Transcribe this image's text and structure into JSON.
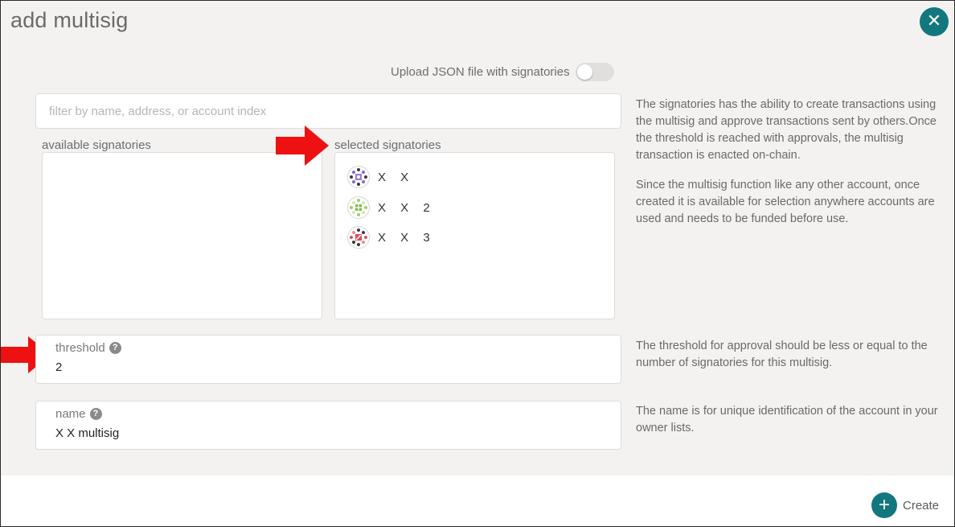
{
  "modal": {
    "title": "add multisig",
    "close_icon": "close-icon"
  },
  "upload": {
    "label": "Upload JSON file with signatories",
    "toggle_on": false
  },
  "filter": {
    "placeholder": "filter by name, address, or account index",
    "value": ""
  },
  "available": {
    "label": "available signatories",
    "items": []
  },
  "selected": {
    "label": "selected signatories",
    "items": [
      {
        "name": "X X",
        "avatar_icon": "identicon-purple"
      },
      {
        "name": "X X 2",
        "avatar_icon": "identicon-green"
      },
      {
        "name": "X X 3",
        "avatar_icon": "identicon-red"
      }
    ]
  },
  "help": {
    "signatories_p1": "The signatories has the ability to create transactions using the multisig and approve transactions sent by others.Once the threshold is reached with approvals, the multisig transaction is enacted on-chain.",
    "signatories_p2": "Since the multisig function like any other account, once created it is available for selection anywhere accounts are used and needs to be funded before use.",
    "threshold": "The threshold for approval should be less or equal to the number of signatories for this multisig.",
    "name": "The name is for unique identification of the account in your owner lists."
  },
  "threshold": {
    "label": "threshold",
    "value": "2",
    "help_icon": "question-icon"
  },
  "name": {
    "label": "name",
    "value": "X X multisig",
    "help_icon": "question-icon"
  },
  "actions": {
    "create_label": "Create",
    "create_icon": "plus-icon"
  },
  "colors": {
    "accent": "#13787d",
    "annotation_arrow": "#ee1111",
    "panel_bg": "#f3f2f1"
  }
}
